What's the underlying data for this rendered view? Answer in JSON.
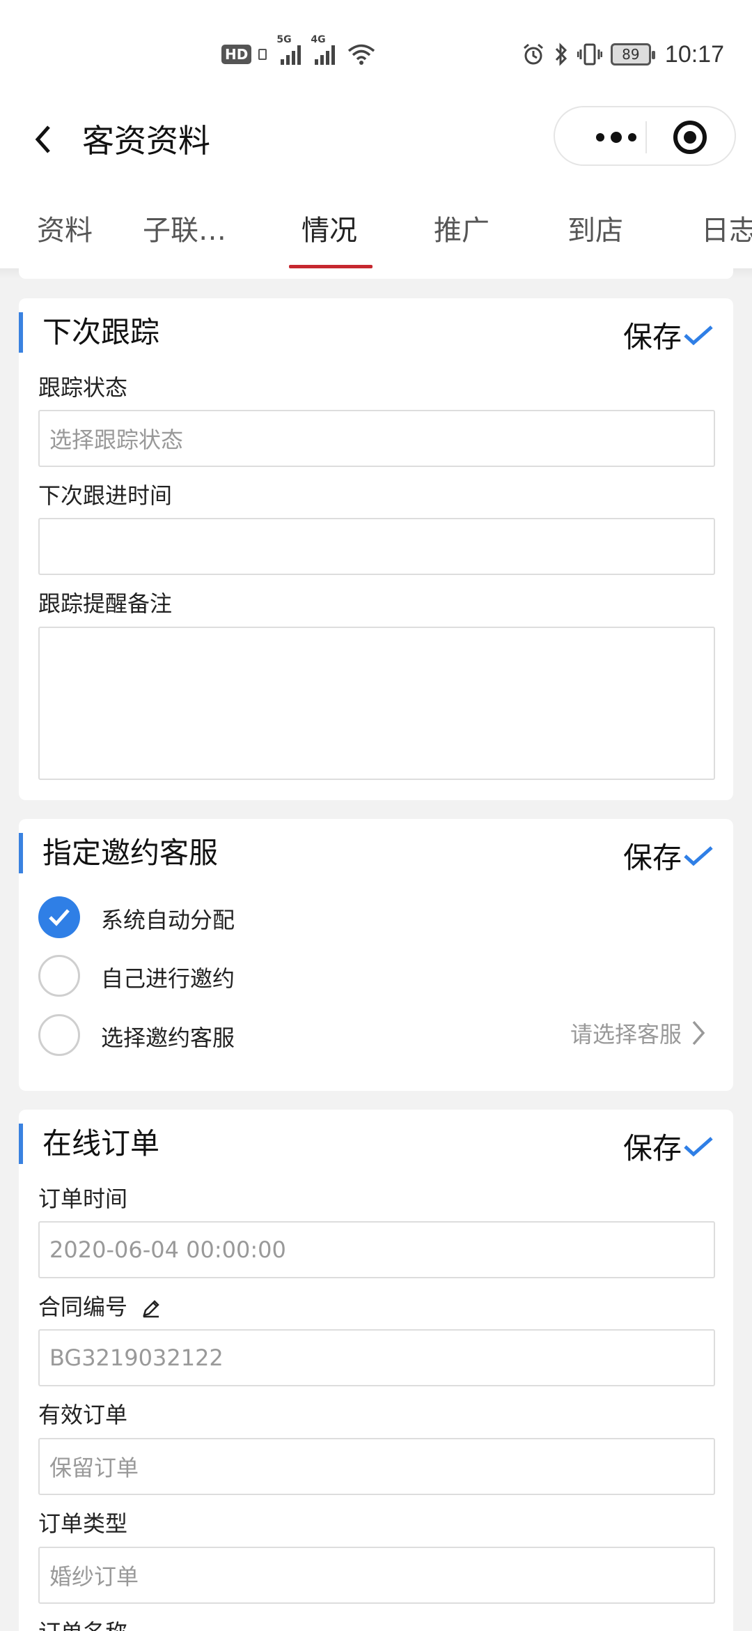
{
  "status_bar": {
    "hd": "HD",
    "net1": "5G",
    "net2": "4G",
    "battery": "89",
    "time": "10:17"
  },
  "nav": {
    "title": "客资资料"
  },
  "tabs": [
    {
      "label": "资料"
    },
    {
      "label": "子联…"
    },
    {
      "label": "情况",
      "active": true
    },
    {
      "label": "推广"
    },
    {
      "label": "到店"
    },
    {
      "label": "日志"
    }
  ],
  "followup": {
    "title": "下次跟踪",
    "save": "保存",
    "status_label": "跟踪状态",
    "status_placeholder": "选择跟踪状态",
    "next_time_label": "下次跟进时间",
    "next_time_value": "",
    "remark_label": "跟踪提醒备注",
    "remark_value": ""
  },
  "invite": {
    "title": "指定邀约客服",
    "save": "保存",
    "options": [
      {
        "label": "系统自动分配",
        "checked": true
      },
      {
        "label": "自己进行邀约",
        "checked": false
      },
      {
        "label": "选择邀约客服",
        "checked": false
      }
    ],
    "select_hint": "请选择客服"
  },
  "order": {
    "title": "在线订单",
    "save": "保存",
    "order_time_label": "订单时间",
    "order_time_value": "2020-06-04 00:00:00",
    "contract_label": "合同编号",
    "contract_value": "BG3219032122",
    "valid_label": "有效订单",
    "valid_value": "保留订单",
    "type_label": "订单类型",
    "type_value": "婚纱订单",
    "name_label": "订单名称"
  },
  "colors": {
    "accent_blue": "#2f7fe6",
    "tab_underline": "#c6282f"
  }
}
